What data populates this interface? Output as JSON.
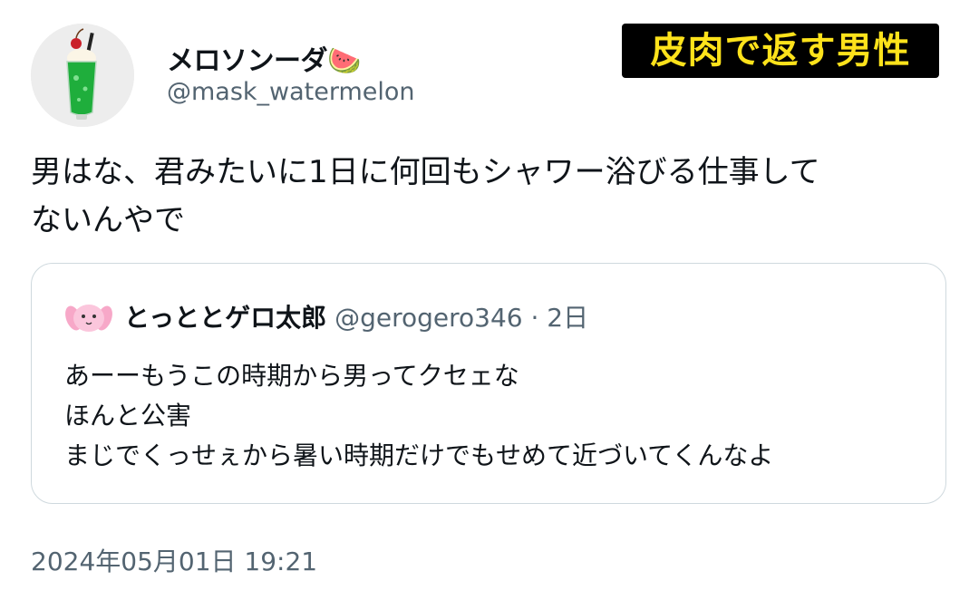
{
  "author": {
    "display_name": "メロソンーダ🍉",
    "handle": "@mask_watermelon",
    "avatar_icon": "cream-soda-icon"
  },
  "caption_badge": "皮肉で返す男性",
  "tweet": {
    "text": "男はな、君みたいに1日に何回もシャワー浴びる仕事して\nないんやで"
  },
  "quote": {
    "display_name": "とっととゲロ太郎",
    "handle": "@gerogero346",
    "separator": "·",
    "time": "2日",
    "avatar_icon": "pink-bunny-icon",
    "text": "あーーもうこの時期から男ってクセェな\nほんと公害\nまじでくっせぇから暑い時期だけでもせめて近づいてくんなよ"
  },
  "timestamp": "2024年05月01日 19:21",
  "colors": {
    "text_primary": "#0f1419",
    "text_secondary": "#536471",
    "border": "#cfd9de",
    "badge_text": "#fde21b",
    "badge_bg": "#000000"
  }
}
